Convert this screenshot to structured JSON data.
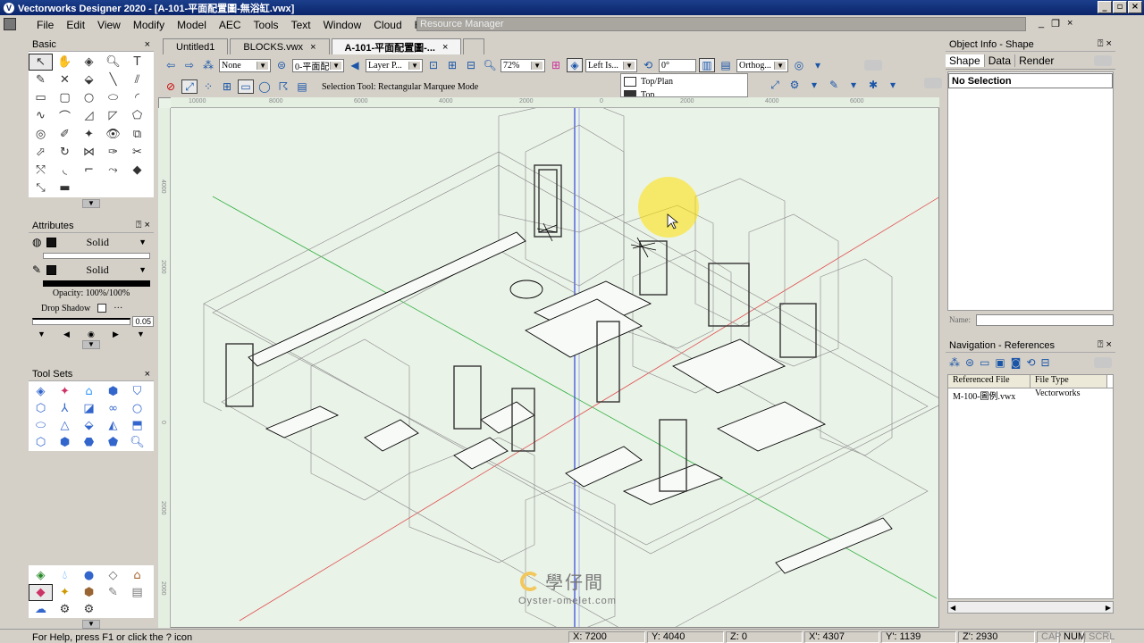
{
  "window": {
    "title": "Vectorworks Designer 2020 - [A-101-平面配置圖-無浴缸.vwx]",
    "buttons": [
      "_",
      "▫",
      "×"
    ]
  },
  "menubar": {
    "items": [
      "File",
      "Edit",
      "View",
      "Modify",
      "Model",
      "AEC",
      "Tools",
      "Text",
      "Window",
      "Cloud",
      "Help"
    ],
    "resource_manager": "Resource Manager"
  },
  "basic_palette": {
    "title": "Basic",
    "close": "×"
  },
  "attributes": {
    "title": "Attributes",
    "fill": "Solid",
    "pen": "Solid",
    "opacity": "Opacity: 100%/100%",
    "drop_shadow": "Drop Shadow",
    "line_weight": "0.05",
    "more": "···"
  },
  "toolsets": {
    "title": "Tool Sets"
  },
  "doc_tabs": [
    {
      "label": "Untitled1",
      "active": false
    },
    {
      "label": "BLOCKS.vwx",
      "active": false
    },
    {
      "label": "A-101-平面配置圖-...",
      "active": true
    }
  ],
  "view_bar": {
    "class_value": "None",
    "layer_value": "0-平面配",
    "layer_plane": "Layer P...",
    "zoom": "72%",
    "view": "Left Is...",
    "angle": "0°",
    "projection": "Orthog..."
  },
  "view_dropdown": {
    "items": [
      "Top/Plan",
      "Top"
    ]
  },
  "tool_bar": {
    "mode_text": "Selection Tool: Rectangular Marquee Mode"
  },
  "rulers": {
    "top": [
      "10000",
      "8000",
      "6000",
      "4000",
      "2000",
      "0",
      "2000",
      "4000",
      "6000"
    ],
    "left": [
      "4000",
      "2000",
      "0",
      "2000",
      "2000"
    ]
  },
  "object_info": {
    "title": "Object Info - Shape",
    "tabs": [
      "Shape",
      "Data",
      "Render"
    ],
    "selection": "No Selection",
    "name_label": "Name:"
  },
  "navigation": {
    "title": "Navigation - References",
    "columns": [
      "Referenced File",
      "File Type"
    ],
    "rows": [
      {
        "file": "M-100-圖例.vwx",
        "type": "Vectorworks"
      }
    ]
  },
  "watermark": {
    "cjk": "學仔間",
    "latin": "Oyster-omelet.com"
  },
  "statusbar": {
    "help": "For Help, press F1 or click the ? icon",
    "x": "X: 7200",
    "y": "Y: 4040",
    "z": "Z: 0",
    "xp": "X': 4307",
    "yp": "Y': 1139",
    "zp": "Z': 2930",
    "cap": "CAP",
    "num": "NUM",
    "scrl": "SCRL"
  },
  "colors": {
    "canvas_bg": "#eaf3e8",
    "axis_red": "#e05050",
    "axis_green": "#30b040",
    "axis_blue": "#3040e0",
    "highlight": "#ffe000"
  }
}
